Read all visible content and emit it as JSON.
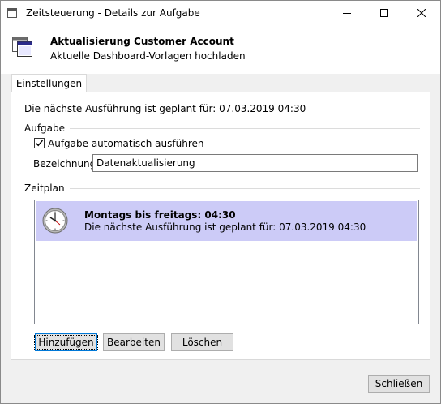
{
  "window": {
    "title": "Zeitsteuerung - Details zur Aufgabe"
  },
  "header": {
    "title": "Aktualisierung Customer Account",
    "subtitle": "Aktuelle Dashboard-Vorlagen hochladen"
  },
  "tabs": [
    {
      "label": "Einstellungen"
    }
  ],
  "settings": {
    "next_run": "Die nächste Ausführung ist geplant für: 07.03.2019 04:30",
    "task_group": {
      "label": "Aufgabe",
      "auto_run_label": "Aufgabe automatisch ausführen",
      "auto_run_checked": true,
      "name_label": "Bezeichnung:",
      "name_value": "Datenaktualisierung"
    },
    "schedule_group": {
      "label": "Zeitplan",
      "items": [
        {
          "title": "Montags bis freitags: 04:30",
          "subtitle": "Die nächste Ausführung ist geplant für: 07.03.2019 04:30",
          "icon": "clock-icon"
        }
      ]
    },
    "buttons": {
      "add": "Hinzufügen",
      "edit": "Bearbeiten",
      "delete": "Löschen"
    }
  },
  "footer": {
    "close": "Schließen"
  },
  "colors": {
    "selection": "#cccbf7",
    "focus": "#0078d7"
  }
}
